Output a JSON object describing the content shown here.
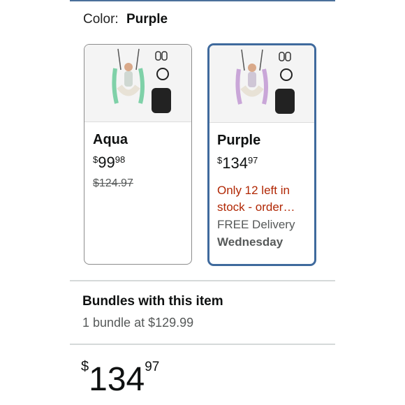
{
  "color_selector": {
    "label": "Color:",
    "selected": "Purple"
  },
  "variants": [
    {
      "name": "Aqua",
      "price": {
        "currency": "$",
        "whole": "99",
        "fraction": "98"
      },
      "list_price": "$124.97",
      "accent": "#7fd1a8"
    },
    {
      "name": "Purple",
      "price": {
        "currency": "$",
        "whole": "134",
        "fraction": "97"
      },
      "stock": "Only 12 left in stock - order…",
      "delivery": "FREE Delivery",
      "delivery_day": "Wednesday",
      "accent": "#c9a6d8",
      "selected": true
    }
  ],
  "bundles": {
    "title": "Bundles with this item",
    "subtitle": "1 bundle at $129.99"
  },
  "main_price": {
    "currency": "$",
    "whole": "134",
    "fraction": "97"
  },
  "colors": {
    "selected_border": "#3f6a9d",
    "stock_text": "#b12704",
    "muted_text": "#565959"
  }
}
